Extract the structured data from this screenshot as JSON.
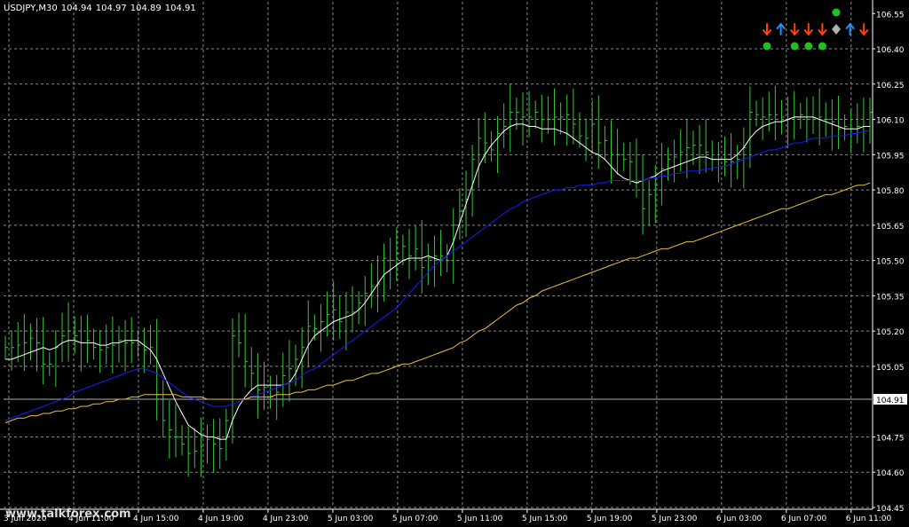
{
  "header": {
    "symbol": "USDJPY,M30",
    "open": "104.94",
    "high": "104.97",
    "low": "104.89",
    "close": "104.91"
  },
  "watermark": "www.talkforex.com",
  "colors": {
    "background": "#000000",
    "grid": "#8a8a8a",
    "candle": "#39c639",
    "ma_fast": "#ffffff",
    "ma_mid": "#1a1aff",
    "ma_slow": "#e8c040",
    "price_line": "#b0b0b0",
    "arrow_down": "#ff4010",
    "arrow_up": "#2090ff",
    "dot": "#20c020",
    "diamond": "#b0b0b0"
  },
  "signals": {
    "row1": [
      {
        "type": "arrow-down"
      },
      {
        "type": "arrow-up"
      },
      {
        "type": "arrow-down"
      },
      {
        "type": "arrow-down"
      },
      {
        "type": "arrow-down"
      },
      {
        "type": "diamond"
      },
      {
        "type": "arrow-up"
      },
      {
        "type": "arrow-down"
      }
    ],
    "row2_dots": [
      0,
      2,
      3,
      4
    ],
    "top_dot": 5
  },
  "chart_data": {
    "type": "line",
    "title": "USDJPY,M30",
    "ylim": [
      104.45,
      106.6
    ],
    "y_ticks": [
      "106.55",
      "106.40",
      "106.25",
      "106.10",
      "105.95",
      "105.80",
      "105.65",
      "105.50",
      "105.35",
      "105.20",
      "105.05",
      "104.91",
      "104.75",
      "104.60",
      "104.45"
    ],
    "current_price": 104.91,
    "x_ticks": [
      "3 Jun 2020",
      "4 Jun 11:00",
      "4 Jun 15:00",
      "4 Jun 19:00",
      "4 Jun 23:00",
      "5 Jun 03:00",
      "5 Jun 07:00",
      "5 Jun 11:00",
      "5 Jun 15:00",
      "5 Jun 19:00",
      "5 Jun 23:00",
      "6 Jun 03:00",
      "6 Jun 07:00",
      "6 Jun 11:00"
    ],
    "bars_close": [
      105.13,
      105.13,
      105.14,
      105.15,
      105.17,
      105.15,
      105.06,
      105.06,
      105.13,
      105.18,
      105.2,
      105.18,
      105.15,
      105.16,
      105.13,
      105.12,
      105.13,
      105.14,
      105.16,
      105.15,
      105.15,
      105.14,
      105.12,
      105.13,
      104.93,
      104.82,
      104.78,
      104.75,
      104.72,
      104.68,
      104.69,
      104.71,
      104.74,
      104.72,
      104.7,
      104.82,
      105.18,
      105.15,
      105.07,
      105.02,
      104.95,
      104.96,
      104.92,
      104.94,
      105.01,
      105.04,
      105.08,
      105.13,
      105.22,
      105.21,
      105.24,
      105.27,
      105.29,
      105.24,
      105.28,
      105.28,
      105.32,
      105.36,
      105.39,
      105.4,
      105.51,
      105.5,
      105.53,
      105.56,
      105.52,
      105.55,
      105.47,
      105.51,
      105.52,
      105.52,
      105.5,
      105.65,
      105.71,
      105.76,
      105.93,
      106.02,
      106.0,
      105.97,
      106.04,
      106.07,
      106.13,
      106.13,
      106.11,
      106.11,
      106.13,
      106.1,
      106.1,
      106.11,
      106.11,
      106.12,
      106.08,
      106.03,
      106.02,
      106.08,
      106.0,
      106.01,
      105.95,
      105.95,
      105.93,
      105.92,
      105.83,
      105.72,
      105.78,
      105.82,
      105.89,
      105.93,
      105.94,
      105.96,
      105.98,
      105.99,
      105.99,
      105.96,
      105.93,
      105.93,
      105.92,
      105.92,
      105.93,
      105.98,
      106.13,
      106.12,
      106.11,
      106.12,
      106.12,
      106.11,
      106.1,
      106.11,
      106.12,
      106.1,
      106.1,
      106.11,
      106.1,
      106.09,
      106.06,
      106.07,
      106.06,
      106.07,
      106.07,
      106.13
    ],
    "series": [
      {
        "values": [
          105.08,
          105.08,
          105.09,
          105.1,
          105.11,
          105.12,
          105.13,
          105.12,
          105.13,
          105.15,
          105.16,
          105.16,
          105.15,
          105.15,
          105.15,
          105.14,
          105.14,
          105.15,
          105.15,
          105.16,
          105.16,
          105.16,
          105.14,
          105.12,
          105.08,
          105.02,
          104.96,
          104.9,
          104.85,
          104.8,
          104.78,
          104.76,
          104.75,
          104.75,
          104.74,
          104.74,
          104.82,
          104.88,
          104.92,
          104.95,
          104.97,
          104.97,
          104.97,
          104.97,
          104.97,
          104.98,
          105.02,
          105.08,
          105.14,
          105.18,
          105.2,
          105.22,
          105.24,
          105.25,
          105.26,
          105.27,
          105.29,
          105.32,
          105.36,
          105.4,
          105.44,
          105.46,
          105.48,
          105.5,
          105.51,
          105.51,
          105.51,
          105.52,
          105.51,
          105.5,
          105.52,
          105.58,
          105.66,
          105.74,
          105.82,
          105.9,
          105.95,
          105.99,
          106.02,
          106.05,
          106.07,
          106.08,
          106.08,
          106.07,
          106.07,
          106.06,
          106.06,
          106.06,
          106.05,
          106.04,
          106.02,
          106.0,
          105.98,
          105.96,
          105.95,
          105.93,
          105.9,
          105.87,
          105.85,
          105.84,
          105.83,
          105.84,
          105.85,
          105.86,
          105.88,
          105.89,
          105.9,
          105.91,
          105.92,
          105.93,
          105.94,
          105.94,
          105.93,
          105.93,
          105.93,
          105.93,
          105.95,
          105.98,
          106.02,
          106.05,
          106.07,
          106.08,
          106.09,
          106.09,
          106.1,
          106.11,
          106.11,
          106.11,
          106.11,
          106.1,
          106.09,
          106.08,
          106.07,
          106.06,
          106.06,
          106.06,
          106.07,
          106.07
        ]
      },
      {
        "values": [
          104.82,
          104.83,
          104.84,
          104.85,
          104.86,
          104.87,
          104.88,
          104.89,
          104.9,
          104.91,
          104.92,
          104.94,
          104.95,
          104.96,
          104.97,
          104.98,
          104.99,
          105.0,
          105.01,
          105.02,
          105.03,
          105.04,
          105.04,
          105.03,
          105.02,
          105.0,
          104.98,
          104.96,
          104.94,
          104.92,
          104.91,
          104.9,
          104.89,
          104.88,
          104.88,
          104.88,
          104.89,
          104.9,
          104.91,
          104.92,
          104.93,
          104.94,
          104.95,
          104.96,
          104.97,
          104.98,
          104.99,
          105.01,
          105.03,
          105.04,
          105.06,
          105.08,
          105.1,
          105.12,
          105.14,
          105.16,
          105.18,
          105.2,
          105.22,
          105.24,
          105.26,
          105.28,
          105.3,
          105.33,
          105.36,
          105.39,
          105.42,
          105.45,
          105.48,
          105.5,
          105.52,
          105.54,
          105.56,
          105.58,
          105.6,
          105.62,
          105.64,
          105.66,
          105.68,
          105.7,
          105.72,
          105.73,
          105.75,
          105.76,
          105.77,
          105.78,
          105.79,
          105.8,
          105.8,
          105.81,
          105.81,
          105.82,
          105.82,
          105.82,
          105.83,
          105.83,
          105.84,
          105.84,
          105.84,
          105.84,
          105.84,
          105.84,
          105.85,
          105.85,
          105.86,
          105.86,
          105.87,
          105.87,
          105.88,
          105.88,
          105.88,
          105.89,
          105.89,
          105.9,
          105.9,
          105.91,
          105.92,
          105.93,
          105.94,
          105.95,
          105.96,
          105.97,
          105.97,
          105.98,
          105.99,
          106.0,
          106.0,
          106.01,
          106.02,
          106.02,
          106.02,
          106.03,
          106.03,
          106.03,
          106.04,
          106.04,
          106.05,
          106.05
        ]
      },
      {
        "values": [
          104.81,
          104.82,
          104.83,
          104.83,
          104.84,
          104.84,
          104.85,
          104.85,
          104.86,
          104.86,
          104.87,
          104.87,
          104.88,
          104.88,
          104.89,
          104.89,
          104.9,
          104.9,
          104.91,
          104.91,
          104.92,
          104.92,
          104.93,
          104.93,
          104.93,
          104.93,
          104.93,
          104.93,
          104.92,
          104.92,
          104.92,
          104.92,
          104.91,
          104.91,
          104.91,
          104.91,
          104.91,
          104.91,
          104.91,
          104.92,
          104.92,
          104.92,
          104.92,
          104.93,
          104.93,
          104.93,
          104.94,
          104.94,
          104.95,
          104.95,
          104.96,
          104.97,
          104.97,
          104.98,
          104.99,
          104.99,
          105.0,
          105.01,
          105.02,
          105.02,
          105.03,
          105.04,
          105.05,
          105.06,
          105.06,
          105.07,
          105.08,
          105.09,
          105.1,
          105.11,
          105.12,
          105.13,
          105.15,
          105.16,
          105.18,
          105.2,
          105.21,
          105.23,
          105.25,
          105.27,
          105.29,
          105.31,
          105.32,
          105.34,
          105.35,
          105.37,
          105.38,
          105.39,
          105.4,
          105.41,
          105.42,
          105.43,
          105.44,
          105.45,
          105.46,
          105.47,
          105.48,
          105.49,
          105.5,
          105.51,
          105.51,
          105.52,
          105.53,
          105.54,
          105.55,
          105.55,
          105.56,
          105.57,
          105.58,
          105.58,
          105.59,
          105.6,
          105.61,
          105.62,
          105.63,
          105.64,
          105.65,
          105.66,
          105.67,
          105.68,
          105.69,
          105.7,
          105.71,
          105.72,
          105.72,
          105.73,
          105.74,
          105.75,
          105.76,
          105.77,
          105.78,
          105.78,
          105.79,
          105.8,
          105.81,
          105.82,
          105.82,
          105.83
        ]
      }
    ]
  }
}
